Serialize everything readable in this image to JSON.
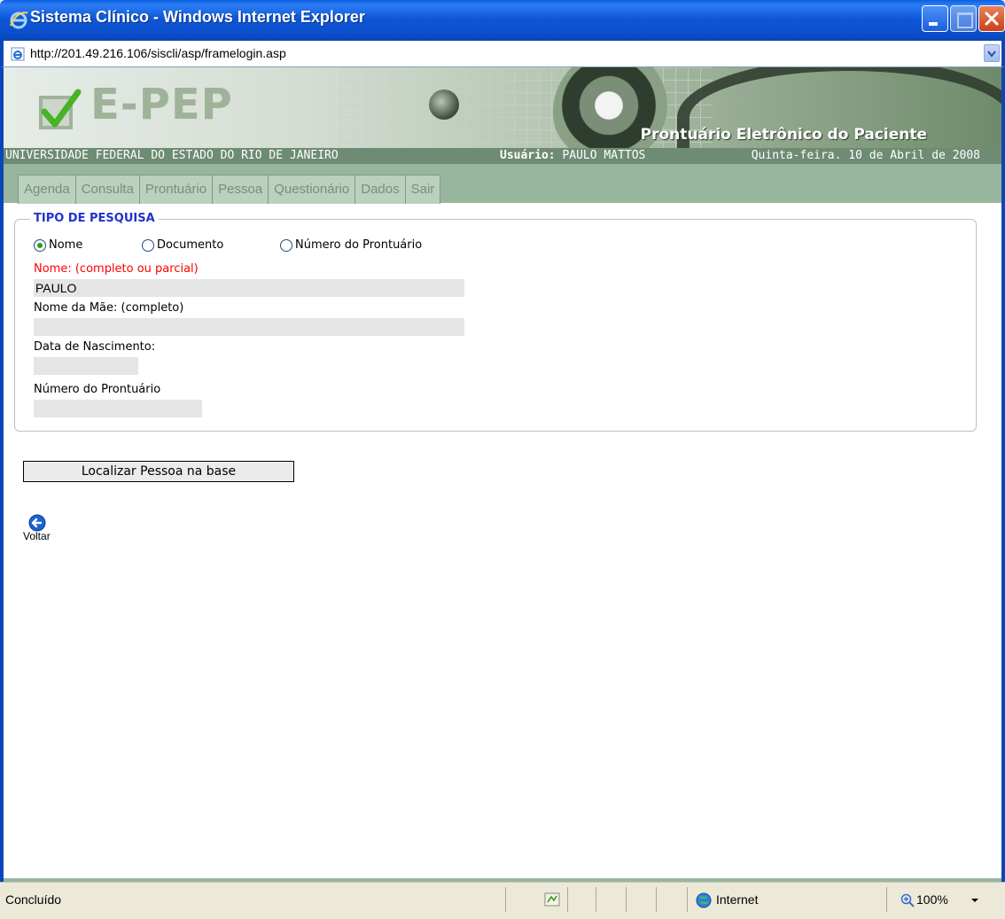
{
  "window": {
    "title": "Sistema Clínico - Windows Internet Explorer",
    "address": "http://201.49.216.106/siscli/asp/framelogin.asp"
  },
  "banner": {
    "logo_text": "E-PEP",
    "subtitle": "Prontuário Eletrônico do Paciente",
    "university": "UNIVERSIDADE FEDERAL DO ESTADO DO RIO DE JANEIRO",
    "user_label": "Usuário:",
    "user_name": "PAULO MATTOS",
    "date": "Quinta-feira. 10 de Abril de 2008"
  },
  "nav": {
    "tabs": [
      "Agenda",
      "Consulta",
      "Prontuário",
      "Pessoa",
      "Questionário",
      "Dados",
      "Sair"
    ]
  },
  "search": {
    "legend": "TIPO DE PESQUISA",
    "radios": [
      {
        "label": "Nome",
        "checked": true
      },
      {
        "label": "Documento",
        "checked": false
      },
      {
        "label": "Número do Prontuário",
        "checked": false
      }
    ],
    "fields": {
      "nome_label": "Nome: (completo ou parcial)",
      "nome_value": "PAULO",
      "mae_label": "Nome da Mãe: (completo)",
      "mae_value": "",
      "nasc_label": "Data de Nascimento:",
      "nasc_value": "",
      "prontuario_label": "Número do Prontuário",
      "prontuario_value": ""
    },
    "submit_label": "Localizar Pessoa na base",
    "back_label": "Voltar"
  },
  "status": {
    "text": "Concluído",
    "zone": "Internet",
    "zoom": "100%"
  },
  "colors": {
    "title_blue": "#0a46b8",
    "nav_green": "#98b59d",
    "legend_blue": "#2233cc",
    "required_red": "#ff0000"
  }
}
